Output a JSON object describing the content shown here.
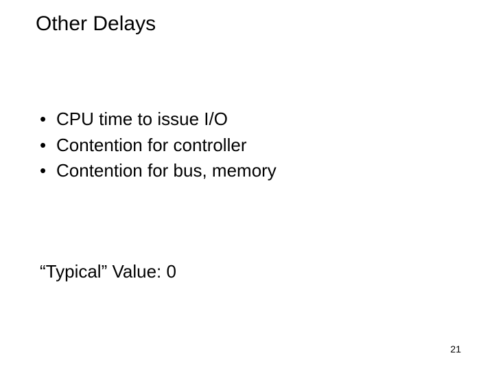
{
  "title": "Other Delays",
  "bullets": [
    "CPU time to issue I/O",
    "Contention for controller",
    "Contention for bus, memory"
  ],
  "typical_line": "“Typical” Value: 0",
  "page_number": "21",
  "bullet_glyph": "•"
}
